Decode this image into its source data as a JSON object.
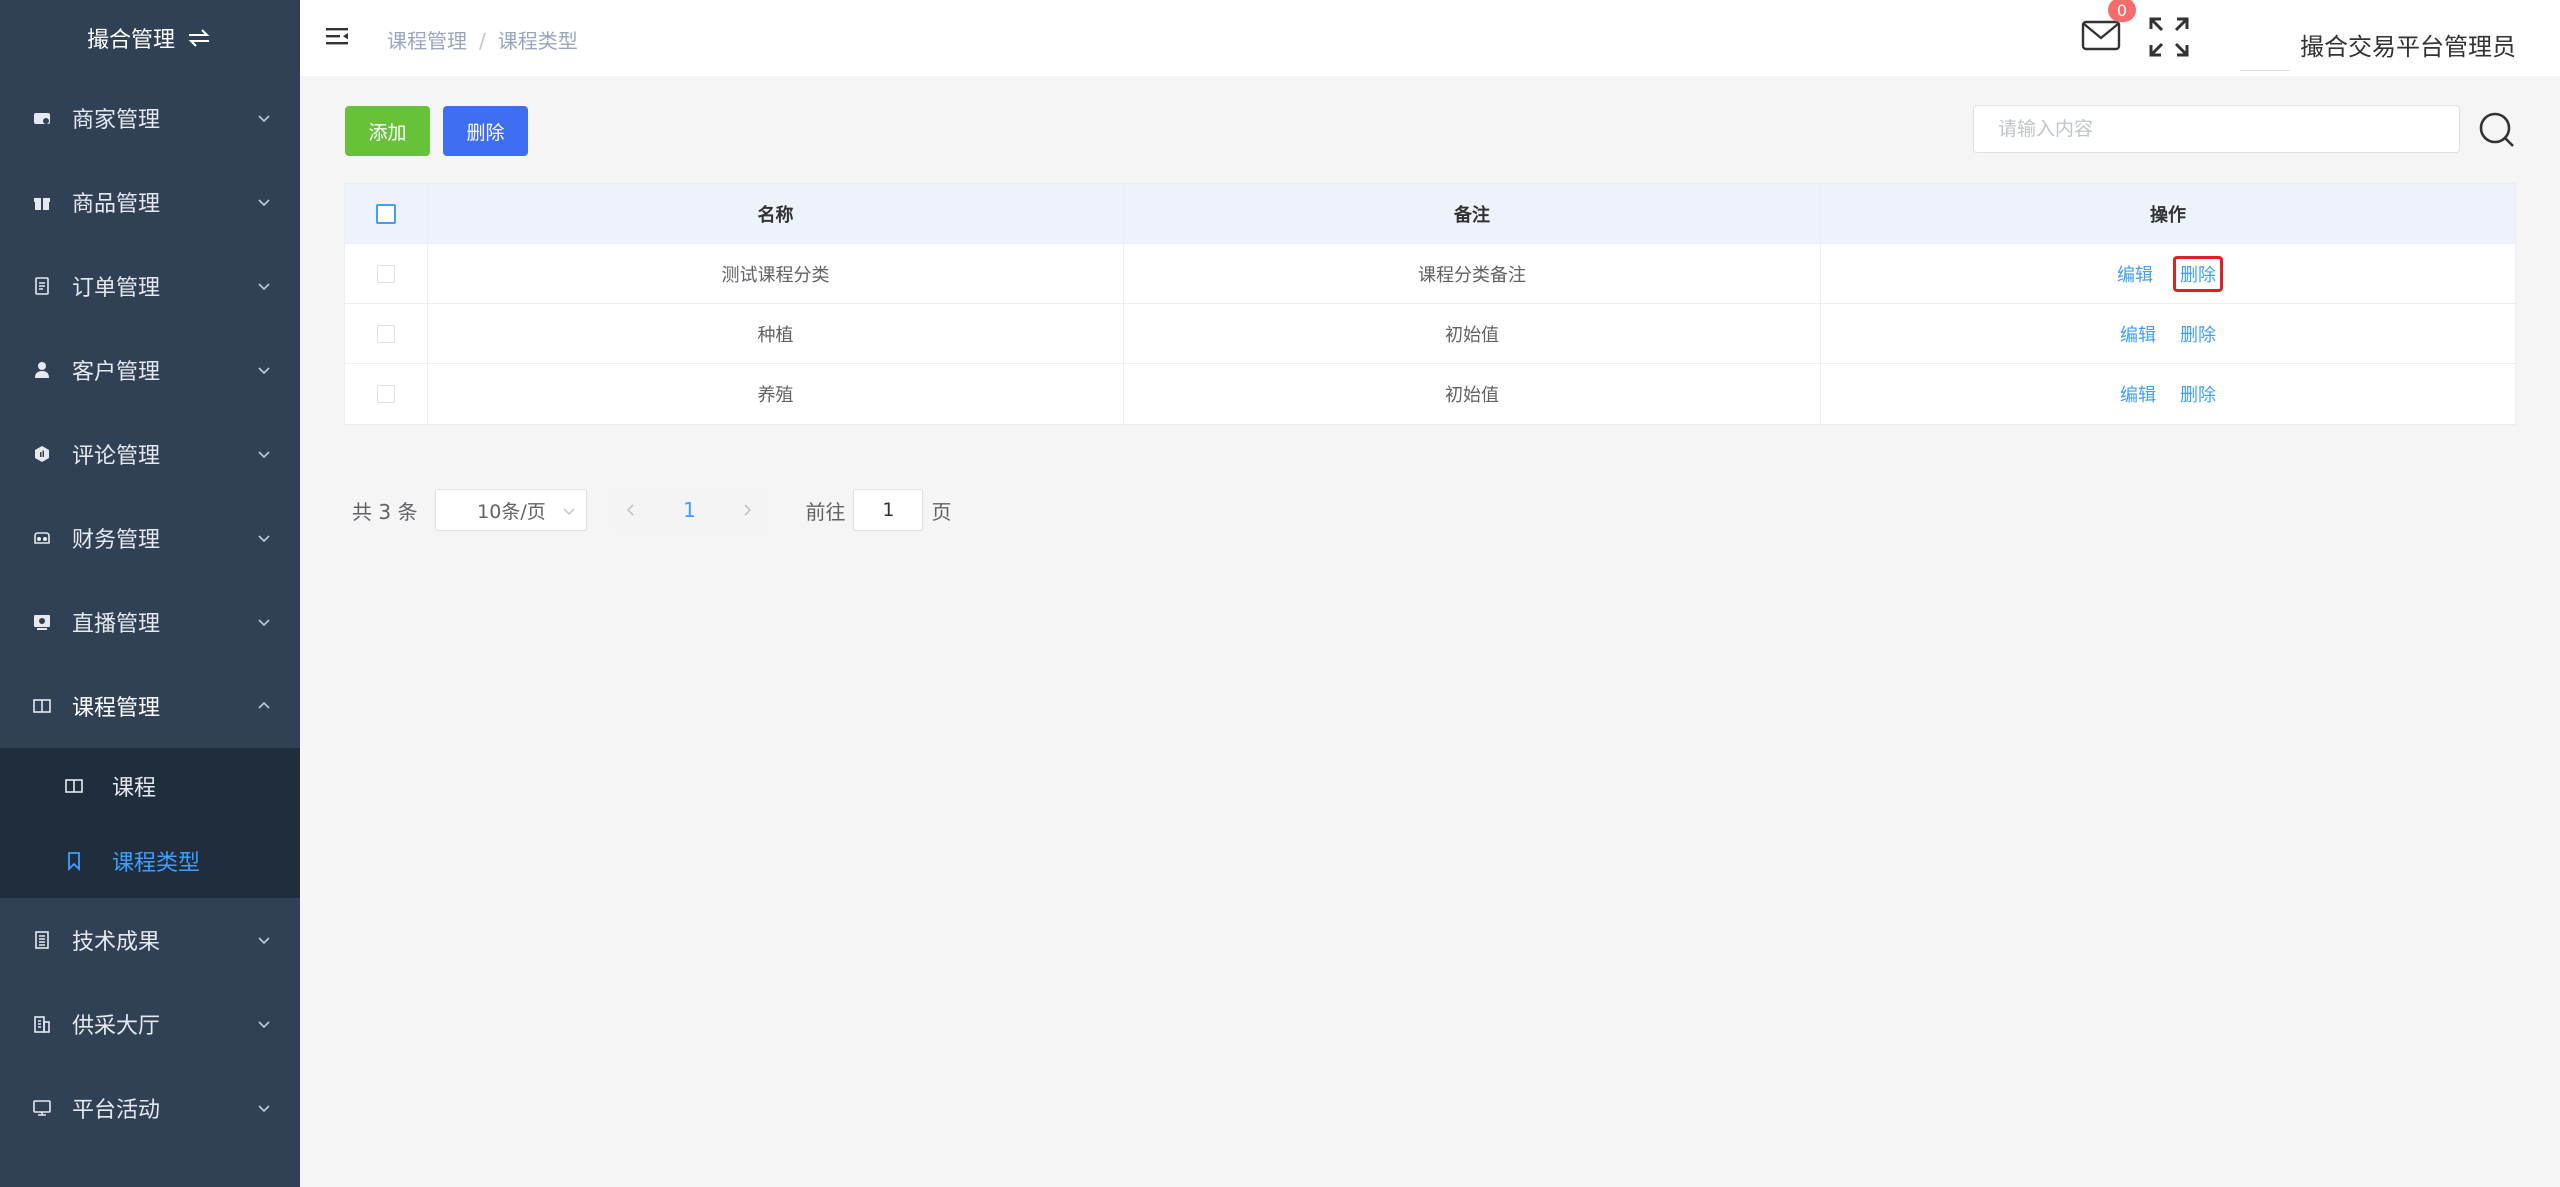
{
  "sidebar": {
    "title": "撮合管理",
    "items": [
      {
        "label": "商家管理",
        "icon": "store-icon"
      },
      {
        "label": "商品管理",
        "icon": "gift-icon"
      },
      {
        "label": "订单管理",
        "icon": "document-icon"
      },
      {
        "label": "客户管理",
        "icon": "user-icon"
      },
      {
        "label": "评论管理",
        "icon": "comment-icon"
      },
      {
        "label": "财务管理",
        "icon": "wallet-icon"
      },
      {
        "label": "直播管理",
        "icon": "live-icon"
      },
      {
        "label": "课程管理",
        "icon": "book-icon"
      }
    ],
    "submenu": [
      {
        "label": "课程",
        "icon": "book-icon"
      },
      {
        "label": "课程类型",
        "icon": "bookmark-icon"
      }
    ],
    "items_after": [
      {
        "label": "技术成果",
        "icon": "list-icon"
      },
      {
        "label": "供采大厅",
        "icon": "building-icon"
      },
      {
        "label": "平台活动",
        "icon": "monitor-icon"
      }
    ]
  },
  "header": {
    "breadcrumb": [
      "课程管理",
      "课程类型"
    ],
    "separator": "/",
    "mail_badge": "0",
    "username": "撮合交易平台管理员"
  },
  "toolbar": {
    "add_label": "添加",
    "delete_label": "删除",
    "search_placeholder": "请输入内容"
  },
  "table": {
    "headers": [
      "名称",
      "备注",
      "操作"
    ],
    "rows": [
      {
        "name": "测试课程分类",
        "note": "课程分类备注",
        "edit": "编辑",
        "delete": "删除"
      },
      {
        "name": "种植",
        "note": "初始值",
        "edit": "编辑",
        "delete": "删除"
      },
      {
        "name": "养殖",
        "note": "初始值",
        "edit": "编辑",
        "delete": "删除"
      }
    ]
  },
  "pagination": {
    "total": "共 3 条",
    "page_size": "10条/页",
    "current_page": "1",
    "goto_prefix": "前往",
    "goto_value": "1",
    "goto_suffix": "页"
  },
  "colors": {
    "sidebar_bg": "#304156",
    "submenu_bg": "#1f2d3d",
    "accent": "#409eff",
    "add_button": "#67c23a",
    "delete_button": "#3e6ff2",
    "badge": "#f56c6c",
    "highlight": "#e02020"
  }
}
